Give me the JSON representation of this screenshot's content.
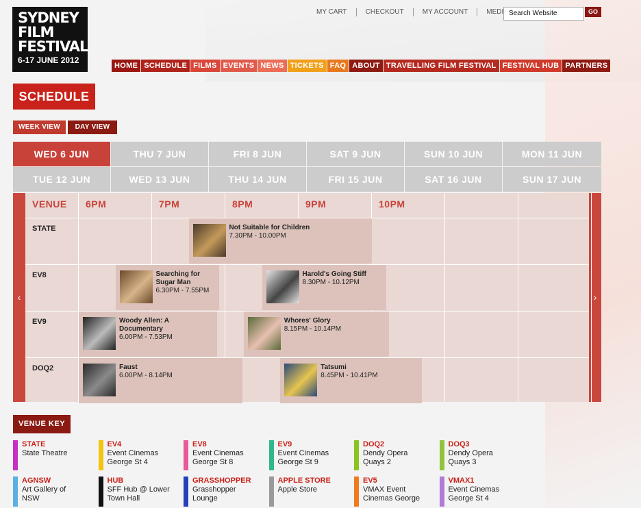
{
  "logo": {
    "line1": "SYDNEY",
    "line2": "FILM",
    "line3": "FESTIVAL",
    "dates": "6-17 JUNE 2012"
  },
  "util_nav": [
    "MY CART",
    "CHECKOUT",
    "MY ACCOUNT",
    "MEDIA"
  ],
  "search": {
    "value": "Search Website",
    "go": "GO"
  },
  "main_nav": [
    {
      "label": "HOME",
      "color": "#9a1711"
    },
    {
      "label": "SCHEDULE",
      "color": "#b0231b"
    },
    {
      "label": "FILMS",
      "color": "#d9473a"
    },
    {
      "label": "EVENTS",
      "color": "#e05a4c"
    },
    {
      "label": "NEWS",
      "color": "#eb6d57"
    },
    {
      "label": "TICKETS",
      "color": "#f1a01a"
    },
    {
      "label": "FAQ",
      "color": "#e8781e"
    },
    {
      "label": "ABOUT",
      "color": "#8e1a12"
    },
    {
      "label": "TRAVELLING FILM FESTIVAL",
      "color": "#b52a20"
    },
    {
      "label": "FESTIVAL HUB",
      "color": "#cf3a2b"
    },
    {
      "label": "PARTNERS",
      "color": "#8e1a12"
    }
  ],
  "page_title": "SCHEDULE",
  "view_buttons": {
    "week": "WEEK VIEW",
    "day": "DAY VIEW"
  },
  "date_tabs": [
    [
      "WED 6 JUN",
      "THU 7 JUN",
      "FRI 8 JUN",
      "SAT 9 JUN",
      "SUN 10 JUN",
      "MON 11 JUN"
    ],
    [
      "TUE 12 JUN",
      "WED 13 JUN",
      "THU 14 JUN",
      "FRI 15 JUN",
      "SAT 16 JUN",
      "SUN 17 JUN"
    ]
  ],
  "active_date": "WED 6 JUN",
  "grid": {
    "venue_header": "VENUE",
    "times": [
      "6PM",
      "7PM",
      "8PM",
      "9PM",
      "10PM"
    ],
    "arrows": {
      "left": "‹",
      "right": "›"
    },
    "venues": [
      "STATE",
      "EV8",
      "EV9",
      "DOQ2"
    ]
  },
  "events": [
    {
      "venue": "STATE",
      "title": "Not Suitable for Children",
      "time": "7.30PM - 10.00PM",
      "thumb_colors": [
        "#4a3a2a",
        "#c49a5a"
      ]
    },
    {
      "venue": "EV8",
      "title": "Searching for Sugar Man",
      "time": "6.30PM - 7.55PM",
      "thumb_colors": [
        "#6b4a2a",
        "#d7b48a"
      ]
    },
    {
      "venue": "EV8",
      "title": "Harold's Going Stiff",
      "time": "8.30PM - 10.12PM",
      "thumb_colors": [
        "#e4e4e4",
        "#444"
      ]
    },
    {
      "venue": "EV9",
      "title": "Woody Allen: A Documentary",
      "time": "6.00PM - 7.53PM",
      "thumb_colors": [
        "#222",
        "#bbb"
      ]
    },
    {
      "venue": "EV9",
      "title": "Whores' Glory",
      "time": "8.15PM - 10.14PM",
      "thumb_colors": [
        "#5a6a3a",
        "#e8c0b0"
      ]
    },
    {
      "venue": "DOQ2",
      "title": "Faust",
      "time": "6.00PM - 8.14PM",
      "thumb_colors": [
        "#2a2a2a",
        "#8a8a8a"
      ]
    },
    {
      "venue": "DOQ2",
      "title": "Tatsumi",
      "time": "8.45PM - 10.41PM",
      "thumb_colors": [
        "#2c4a7a",
        "#e6c450"
      ]
    }
  ],
  "venue_key_title": "VENUE KEY",
  "venue_key": [
    {
      "code": "STATE",
      "desc": [
        "State Theatre"
      ],
      "color": "#c62fc3"
    },
    {
      "code": "EV4",
      "desc": [
        "Event Cinemas",
        "George St 4"
      ],
      "color": "#f1c40f"
    },
    {
      "code": "EV8",
      "desc": [
        "Event Cinemas",
        "George St 8"
      ],
      "color": "#e85a9a"
    },
    {
      "code": "EV9",
      "desc": [
        "Event Cinemas",
        "George St 9"
      ],
      "color": "#2fb88a"
    },
    {
      "code": "DOQ2",
      "desc": [
        "Dendy Opera",
        "Quays 2"
      ],
      "color": "#8ac41f"
    },
    {
      "code": "DOQ3",
      "desc": [
        "Dendy Opera",
        "Quays 3"
      ],
      "color": "#8fc43a"
    },
    {
      "code": "AGNSW",
      "desc": [
        "Art Gallery of",
        "NSW"
      ],
      "color": "#5ab0e0"
    },
    {
      "code": "HUB",
      "desc": [
        "SFF Hub @ Lower",
        "Town Hall"
      ],
      "color": "#111111"
    },
    {
      "code": "GRASSHOPPER",
      "desc": [
        "Grasshopper",
        "Lounge"
      ],
      "color": "#2340b8"
    },
    {
      "code": "APPLE STORE",
      "desc": [
        "Apple Store"
      ],
      "color": "#9a9a9a"
    },
    {
      "code": "EV5",
      "desc": [
        "VMAX Event",
        "Cinemas George"
      ],
      "color": "#f07a1e"
    },
    {
      "code": "VMAX1",
      "desc": [
        "Event Cinemas",
        "George St 4"
      ],
      "color": "#b07ad8"
    }
  ]
}
